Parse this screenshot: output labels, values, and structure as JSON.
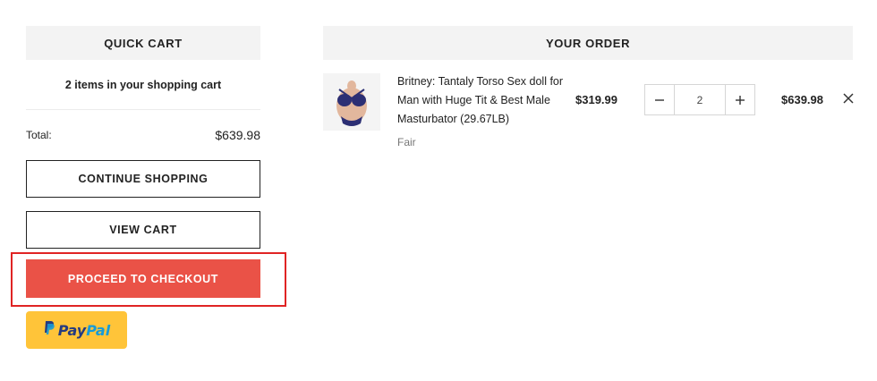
{
  "quick_cart": {
    "header": "QUICK CART",
    "items_text": "2 items in your shopping cart",
    "total_label": "Total:",
    "total_value": "$639.98",
    "continue_label": "CONTINUE SHOPPING",
    "view_cart_label": "VIEW CART",
    "checkout_label": "PROCEED TO CHECKOUT",
    "paypal": {
      "pay": "Pay",
      "pal": "Pal"
    }
  },
  "order": {
    "header": "YOUR ORDER",
    "items": [
      {
        "name": "Britney: Tantaly Torso Sex doll for Man with Huge Tit & Best Male Masturbator (29.67LB)",
        "variant": "Fair",
        "unit_price": "$319.99",
        "quantity": "2",
        "line_total": "$639.98"
      }
    ]
  },
  "icons": {
    "minus": "minus-icon",
    "plus": "plus-icon",
    "remove": "close-icon",
    "paypal": "paypal-logo-icon"
  },
  "colors": {
    "checkout_bg": "#ea5247",
    "paypal_bg": "#ffc439",
    "highlight": "#e02424"
  }
}
